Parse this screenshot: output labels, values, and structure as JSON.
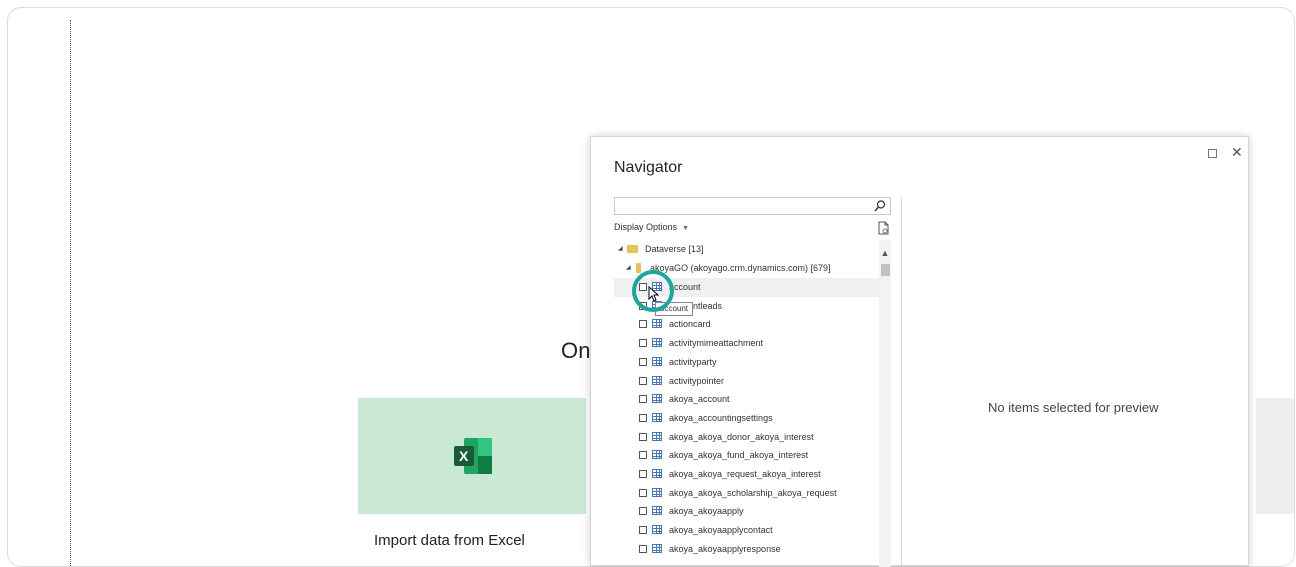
{
  "background": {
    "heading_partial": "On",
    "excel_card": {
      "title": "Import data from Excel",
      "icon": "excel-icon"
    }
  },
  "navigator": {
    "title": "Navigator",
    "search": {
      "placeholder": "",
      "value": ""
    },
    "display_options": "Display Options",
    "root": {
      "label": "Dataverse [13]",
      "expanded": true
    },
    "environment": {
      "label": "akoyaGO (akoyago.crm.dynamics.com) [679]",
      "expanded": true
    },
    "tables": [
      {
        "label": "account",
        "checked": false,
        "selected": true
      },
      {
        "label": "accountleads",
        "checked": false
      },
      {
        "label": "actioncard",
        "checked": false
      },
      {
        "label": "activitymimeattachment",
        "checked": false
      },
      {
        "label": "activityparty",
        "checked": false
      },
      {
        "label": "activitypointer",
        "checked": false
      },
      {
        "label": "akoya_account",
        "checked": false
      },
      {
        "label": "akoya_accountingsettings",
        "checked": false
      },
      {
        "label": "akoya_akoya_donor_akoya_interest",
        "checked": false
      },
      {
        "label": "akoya_akoya_fund_akoya_interest",
        "checked": false
      },
      {
        "label": "akoya_akoya_request_akoya_interest",
        "checked": false
      },
      {
        "label": "akoya_akoya_scholarship_akoya_request",
        "checked": false
      },
      {
        "label": "akoya_akoyaapply",
        "checked": false
      },
      {
        "label": "akoya_akoyaapplycontact",
        "checked": false
      },
      {
        "label": "akoya_akoyaapplyresponse",
        "checked": false
      }
    ],
    "preview_message": "No items selected for preview",
    "tooltip": "account"
  },
  "colors": {
    "highlight": "#1fa59d",
    "excel_green": "#21a366",
    "card_bg": "#c9e9d5"
  }
}
